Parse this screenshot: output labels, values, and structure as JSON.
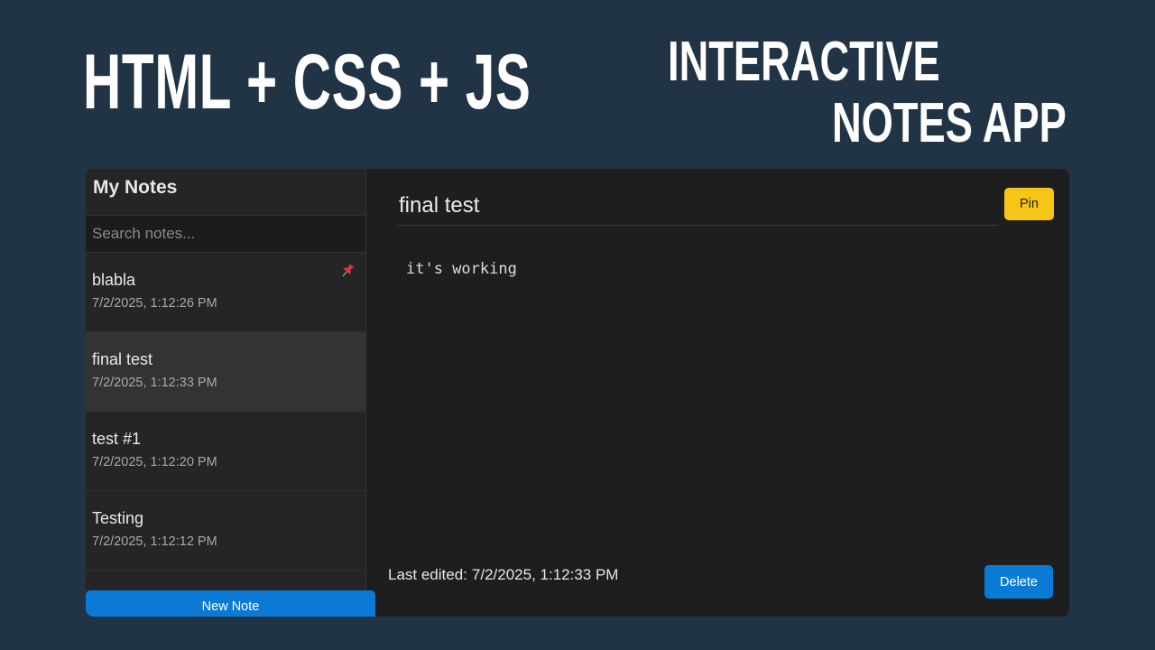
{
  "banner": {
    "main": "HTML + CSS + JS",
    "sub_line1": "INTERACTIVE",
    "sub_line2": "NOTES APP"
  },
  "sidebar": {
    "title": "My Notes",
    "search_placeholder": "Search notes...",
    "notes": [
      {
        "title": "blabla",
        "date": "7/2/2025, 1:12:26 PM",
        "pinned": true,
        "active": false
      },
      {
        "title": "final test",
        "date": "7/2/2025, 1:12:33 PM",
        "pinned": false,
        "active": true
      },
      {
        "title": "test #1",
        "date": "7/2/2025, 1:12:20 PM",
        "pinned": false,
        "active": false
      },
      {
        "title": "Testing",
        "date": "7/2/2025, 1:12:12 PM",
        "pinned": false,
        "active": false
      }
    ],
    "new_note_label": "New Note"
  },
  "editor": {
    "title_value": "final test",
    "pin_label": "Pin",
    "body": "it's working",
    "last_edited_label": "Last edited:",
    "last_edited_value": "7/2/2025, 1:12:33 PM",
    "delete_label": "Delete"
  },
  "colors": {
    "page_background": "#213446",
    "app_background": "#1e1e1e",
    "sidebar_background": "#252526",
    "active_item": "#333334",
    "accent_blue": "#0b7ad7",
    "pin_yellow": "#f5c518"
  },
  "icons": {
    "pin": "pushpin-icon"
  }
}
